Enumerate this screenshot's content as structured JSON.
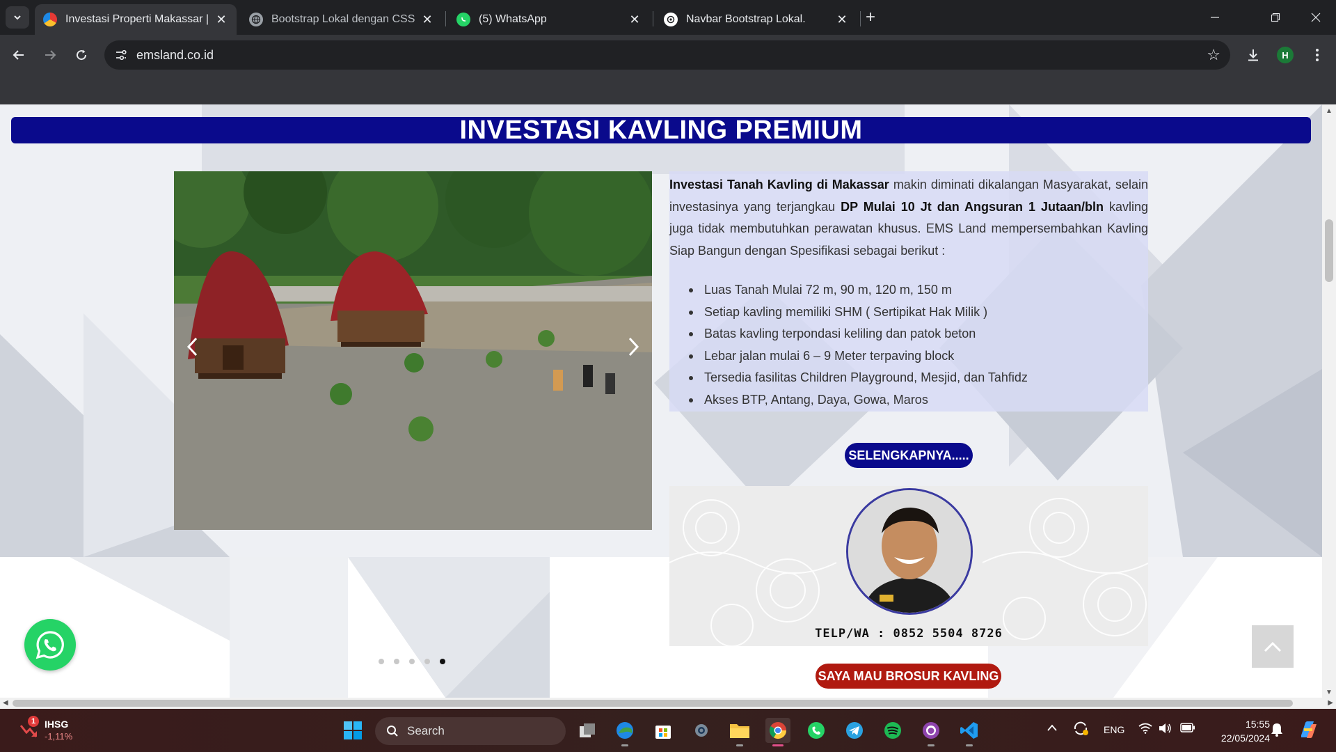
{
  "browser": {
    "tabs": [
      {
        "title": "Investasi Properti Makassar | EMS",
        "active": true
      },
      {
        "title": "Bootstrap Lokal dengan CSS dan",
        "active": false
      },
      {
        "title": "(5) WhatsApp",
        "active": false
      },
      {
        "title": "Navbar Bootstrap Lokal.",
        "active": false
      }
    ],
    "url": "emsland.co.id",
    "profile_initial": "H"
  },
  "page": {
    "title": "INVESTASI KAVLING PREMIUM",
    "desc_bold1": "Investasi Tanah Kavling di Makassar",
    "desc_text1": " makin diminati dikalangan Masyarakat, selain investasinya yang terjangkau ",
    "desc_bold2": "DP Mulai 10 Jt dan Angsuran 1 Jutaan/bln",
    "desc_text2": "  kavling juga tidak membutuhkan perawatan khusus. EMS Land mempersembahkan Kavling Siap Bangun dengan Spesifikasi sebagai berikut :",
    "specs": [
      "Luas Tanah Mulai 72 m, 90 m, 120 m, 150 m",
      "Setiap kavling memiliki SHM ( Sertipikat Hak Milik )",
      "Batas kavling terpondasi keliling dan patok beton",
      "Lebar jalan mulai 6 – 9 Meter terpaving block",
      "Tersedia fasilitas Children Playground, Mesjid, dan Tahfidz",
      "Akses BTP, Antang, Daya, Gowa, Maros"
    ],
    "more_button": "SELENGKAPNYA.....",
    "agent_phone": "TELP/WA : 0852 5504 8726",
    "brosur_button": "SAYA MAU BROSUR KAVLING",
    "carousel_slide_count": 5,
    "carousel_active_index": 4
  },
  "taskbar": {
    "stock_name": "IHSG",
    "stock_change": "-1,11%",
    "stock_badge": "1",
    "search_placeholder": "Search",
    "language": "ENG",
    "time": "15:55",
    "date": "22/05/2024"
  },
  "colors": {
    "brand_blue": "#0a0a8c",
    "cta_red": "#b01a10",
    "whatsapp_green": "#25d366"
  }
}
